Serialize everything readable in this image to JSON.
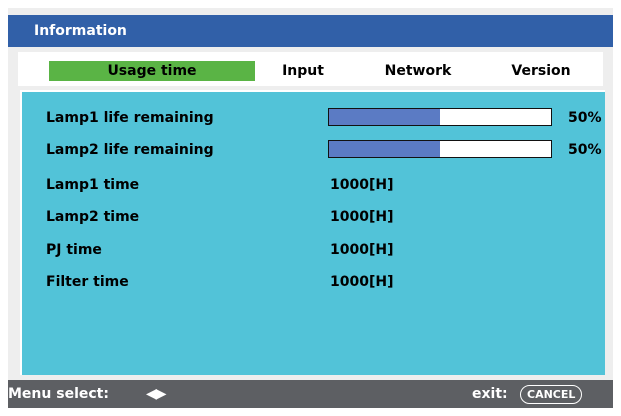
{
  "window": {
    "title": "Information"
  },
  "tabs": [
    {
      "label": "Usage time",
      "active": true
    },
    {
      "label": "Input",
      "active": false
    },
    {
      "label": "Network",
      "active": false
    },
    {
      "label": "Version",
      "active": false
    }
  ],
  "rows": [
    {
      "label": "Lamp1 life remaining",
      "type": "bar",
      "percent": 50,
      "value": "50%"
    },
    {
      "label": "Lamp2 life remaining",
      "type": "bar",
      "percent": 50,
      "value": "50%"
    },
    {
      "label": "Lamp1 time",
      "type": "text",
      "value": "1000[H]"
    },
    {
      "label": "Lamp2 time",
      "type": "text",
      "value": "1000[H]"
    },
    {
      "label": "PJ time",
      "type": "text",
      "value": "1000[H]"
    },
    {
      "label": "Filter time",
      "type": "text",
      "value": "1000[H]"
    }
  ],
  "status": {
    "menu_select_label": "Menu select:",
    "menu_select_icon": "left-right-arrows-icon",
    "exit_label": "exit:",
    "cancel_key": "CANCEL"
  },
  "colors": {
    "title_bg": "#3160a8",
    "active_tab": "#5ab445",
    "panel_bg": "#52c3d8",
    "bar_fill": "#5b7bc4",
    "status_bg": "#5d5f63"
  }
}
